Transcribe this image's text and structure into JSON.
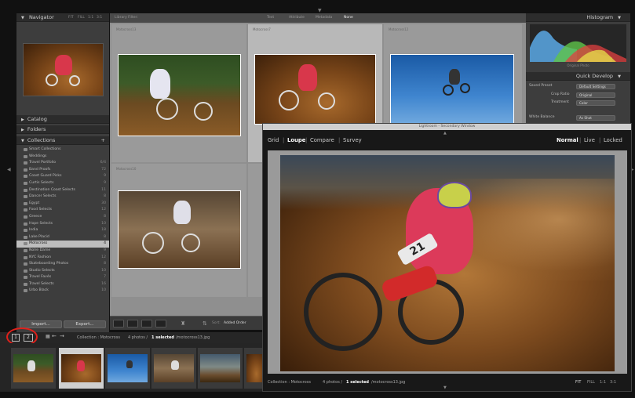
{
  "left_panel": {
    "navigator": {
      "title": "Navigator",
      "zoom_opts": [
        "FIT",
        "FILL",
        "1:1",
        "3:1"
      ]
    },
    "catalog": "Catalog",
    "folders": "Folders",
    "collections": {
      "title": "Collections",
      "items": [
        {
          "label": "Smart Collections",
          "count": ""
        },
        {
          "label": "Weddings",
          "count": ""
        },
        {
          "label": "Travel Portfolio",
          "count": "6/4"
        },
        {
          "label": "Band Proofs",
          "count": "72"
        },
        {
          "label": "Coast Guard Picks",
          "count": "9"
        },
        {
          "label": "Curtis Selects",
          "count": "9"
        },
        {
          "label": "Destination Coast Selects",
          "count": "11"
        },
        {
          "label": "Dancer Selects",
          "count": "8"
        },
        {
          "label": "Egypt",
          "count": "30"
        },
        {
          "label": "Food Selects",
          "count": "12"
        },
        {
          "label": "Greece",
          "count": "8"
        },
        {
          "label": "Hope Selects",
          "count": "10"
        },
        {
          "label": "India",
          "count": "18"
        },
        {
          "label": "Lake Placid",
          "count": "8"
        },
        {
          "label": "Motocross",
          "count": "4"
        },
        {
          "label": "Nolre Dame",
          "count": "9"
        },
        {
          "label": "NYC Fashion",
          "count": "12"
        },
        {
          "label": "Skateboarding Photos",
          "count": "8"
        },
        {
          "label": "Studio Selects",
          "count": "10"
        },
        {
          "label": "Travel Favés",
          "count": "7"
        },
        {
          "label": "Travel Selects",
          "count": "16"
        },
        {
          "label": "Urbo Black",
          "count": "10"
        }
      ]
    },
    "import_label": "Import...",
    "export_label": "Export..."
  },
  "grid": {
    "header_tab": "Library Filter:",
    "filter_tabs": [
      "Text",
      "Attribute",
      "Metadata",
      "None"
    ],
    "cells": [
      {
        "label": "Motocross13"
      },
      {
        "label": "Motocross7"
      },
      {
        "label": "Motocross12"
      },
      {
        "label": "Motocross10"
      }
    ]
  },
  "toolbar": {
    "sort_label": "Sort:",
    "sort_value": "Added Order"
  },
  "right_panel": {
    "histogram_title": "Histogram",
    "original_photo": "Original Photo",
    "quick_develop_title": "Quick Develop",
    "saved_preset_label": "Saved Preset",
    "saved_preset_value": "Default Settings",
    "crop_ratio_label": "Crop Ratio",
    "crop_ratio_value": "Original",
    "treatment_label": "Treatment",
    "treatment_value": "Color",
    "white_balance_label": "White Balance",
    "white_balance_value": "As Shot"
  },
  "secondary_window": {
    "title": "Lightroom - Secondary Window",
    "modes_left": [
      "Grid",
      "Loupe",
      "Compare",
      "Survey"
    ],
    "active_left": "Loupe",
    "modes_right": [
      "Normal",
      "Live",
      "Locked"
    ],
    "active_right": "Normal",
    "status_collection": "Collection : Motocross",
    "status_count": "4 photos /",
    "status_selected": "1 selected",
    "status_file": "/motocross13.jpg",
    "zoom_opts": [
      "FIT",
      "FILL",
      "1:1",
      "3:1"
    ]
  },
  "filmstrip_bar": {
    "page1": "1",
    "page2": "2",
    "collection": "Collection : Motocross",
    "count": "4 photos /",
    "selected": "1 selected",
    "file": "/motocross13.jpg"
  },
  "colors": {
    "highlight_red": "#e0201a",
    "accent_selected": "#cfcfcf"
  }
}
